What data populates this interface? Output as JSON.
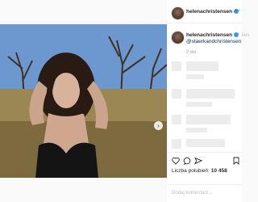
{
  "post": {
    "username": "helenachristensen",
    "caption_fragment": "lies",
    "mention": "@staerkandchristensen",
    "time_ago": "2 dni",
    "likes_label": "Liczba polubień:",
    "likes_count": "10 458",
    "comment_placeholder": "Dodaj komentarz...",
    "more_icon": "…",
    "next_icon": "›"
  },
  "colors": {
    "verified": "#3897f0",
    "mention": "#003569"
  }
}
